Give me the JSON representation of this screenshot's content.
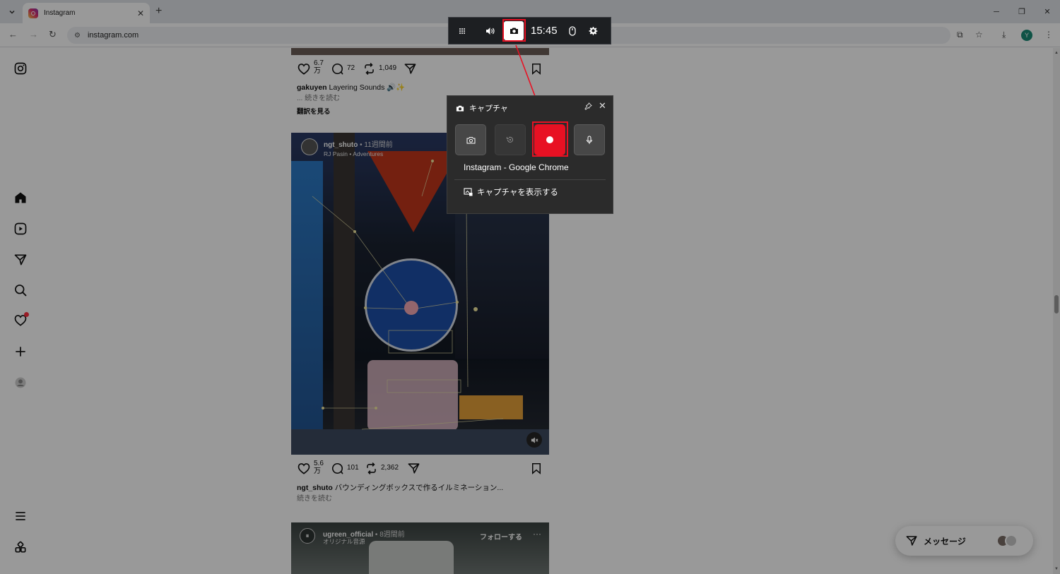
{
  "browser": {
    "tab_title": "Instagram",
    "new_tab": "+",
    "url": "instagram.com",
    "profile_initial": "Y"
  },
  "posts": [
    {
      "likes_line1": "6.7",
      "likes_line2": "万",
      "comments": "72",
      "reposts": "1,049",
      "caption_user": "gakuyen",
      "caption_text": "Layering Sounds 🔊✨",
      "read_more": "... 続きを読む",
      "translate": "翻訳を見る"
    },
    {
      "header_user": "ngt_shuto",
      "header_time": "• 11週間前",
      "header_audio": "RJ Pasin • Adventures",
      "likes_line1": "5.6",
      "likes_line2": "万",
      "comments": "101",
      "reposts": "2,362",
      "caption_user": "ngt_shuto",
      "caption_text": "バウンディングボックスで作るイルミネーション...",
      "read_more": "続きを読む"
    },
    {
      "header_user": "ugreen_official",
      "header_time": "• 8週間前",
      "header_audio": "オリジナル音源",
      "follow": "フォローする",
      "more": "···"
    }
  ],
  "messages_label": "メッセージ",
  "gamebar": {
    "time": "15:45"
  },
  "capture": {
    "title": "キャプチャ",
    "source": "Instagram - Google Chrome",
    "show_captures": "キャプチャを表示する"
  },
  "colors": {
    "highlight": "#e81123",
    "record": "#e81123",
    "widget_bg": "#2b2b2b",
    "instagram_notif": "#ff3040"
  },
  "icons": [
    "instagram-icon",
    "home-icon",
    "reels-icon",
    "direct-icon",
    "search-icon",
    "heart-icon",
    "create-icon",
    "profile-icon",
    "menu-icon",
    "also-from-meta-icon",
    "screenshot-icon",
    "record-last-icon",
    "record-icon",
    "mic-icon",
    "pin-icon",
    "close-icon",
    "volume-icon",
    "settings-icon",
    "mouse-icon"
  ]
}
